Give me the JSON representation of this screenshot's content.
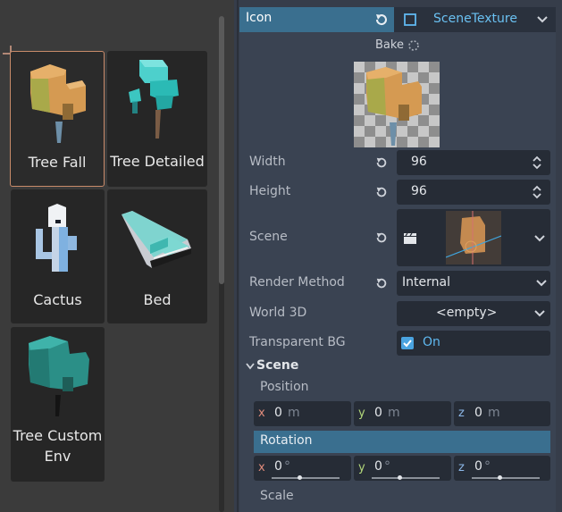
{
  "assets": [
    {
      "label": "Tree Fall"
    },
    {
      "label": "Tree Detailed"
    },
    {
      "label": "Cactus"
    },
    {
      "label": "Bed"
    },
    {
      "label": "Tree Custom Env"
    }
  ],
  "inspector": {
    "header_label": "Icon",
    "header_type": "SceneTexture",
    "bake_label": "Bake",
    "width_label": "Width",
    "width_value": "96",
    "height_label": "Height",
    "height_value": "96",
    "scene_label": "Scene",
    "render_method_label": "Render Method",
    "render_method_value": "Internal",
    "world3d_label": "World 3D",
    "world3d_value": "<empty>",
    "transparent_label": "Transparent BG",
    "transparent_value": "On",
    "scene_section_label": "Scene",
    "position_label": "Position",
    "rotation_label": "Rotation",
    "scale_label": "Scale",
    "position": {
      "x": "0",
      "y": "0",
      "z": "0",
      "unit": "m"
    },
    "rotation": {
      "x": "0",
      "y": "0",
      "z": "0",
      "unit": "°"
    }
  },
  "colors": {
    "accent": "#3a6f8f",
    "checkbox": "#4aa3df",
    "on_text": "#5fb8f0",
    "selected_border": "#c98b6a",
    "axis_x": "#e08b7b",
    "axis_y": "#b2d77a",
    "axis_z": "#8cb7e8"
  }
}
